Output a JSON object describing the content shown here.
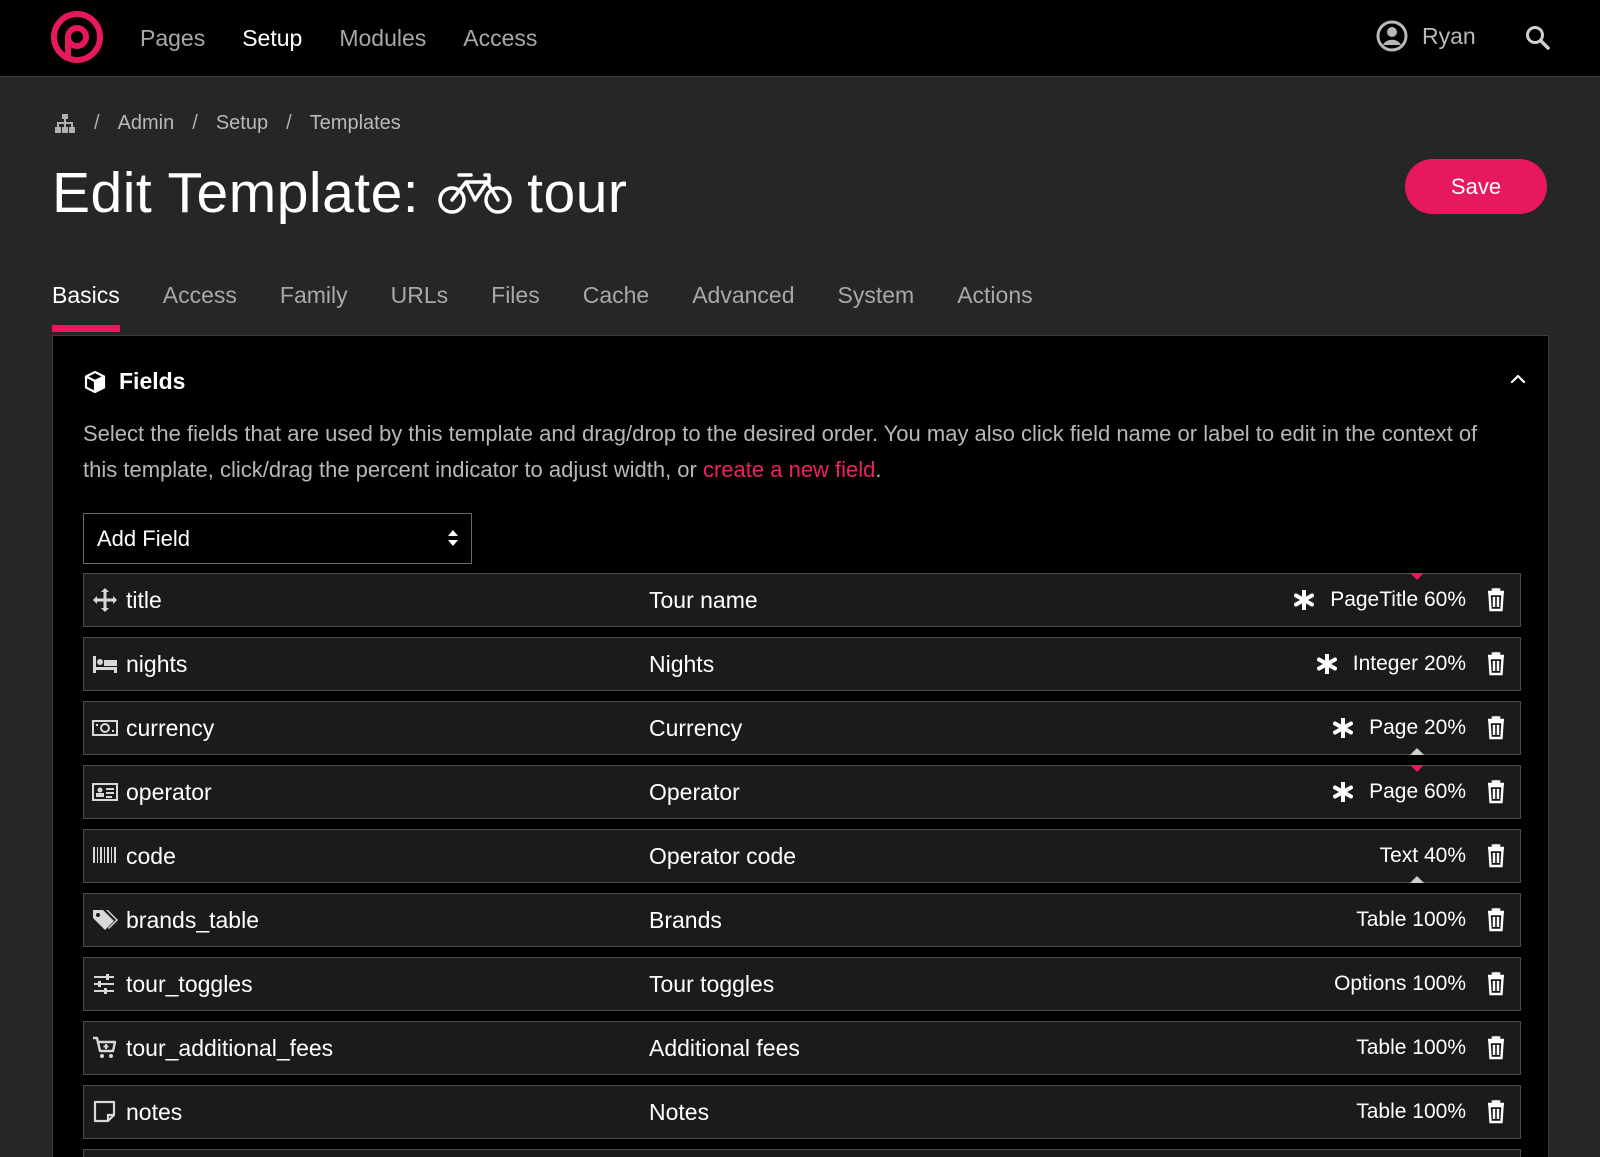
{
  "nav": {
    "items": [
      {
        "label": "Pages",
        "active": false
      },
      {
        "label": "Setup",
        "active": true
      },
      {
        "label": "Modules",
        "active": false
      },
      {
        "label": "Access",
        "active": false
      }
    ],
    "user": "Ryan"
  },
  "breadcrumb": [
    "Admin",
    "Setup",
    "Templates"
  ],
  "title": {
    "prefix": "Edit Template:",
    "name": "tour"
  },
  "save_label": "Save",
  "tabs": [
    "Basics",
    "Access",
    "Family",
    "URLs",
    "Files",
    "Cache",
    "Advanced",
    "System",
    "Actions"
  ],
  "panel": {
    "title": "Fields",
    "description": "Select the fields that are used by this template and drag/drop to the desired order. You may also click field name or label to edit in the context of this template, click/drag the percent indicator to adjust width, or ",
    "link": "create a new field",
    "description_end": "."
  },
  "add_field": {
    "value": "Add Field"
  },
  "colors": {
    "accent": "#e8185f",
    "background": "#262626",
    "panel": "#000000",
    "row": "#1b1b1b"
  },
  "fields": [
    {
      "name": "title",
      "label": "Tour name",
      "type": "PageTitle",
      "width": "60%",
      "required": true,
      "icon": "move-icon"
    },
    {
      "name": "nights",
      "label": "Nights",
      "type": "Integer",
      "width": "20%",
      "required": true,
      "icon": "bed-icon"
    },
    {
      "name": "currency",
      "label": "Currency",
      "type": "Page",
      "width": "20%",
      "required": true,
      "icon": "money-icon"
    },
    {
      "name": "operator",
      "label": "Operator",
      "type": "Page",
      "width": "60%",
      "required": true,
      "icon": "id-card-icon"
    },
    {
      "name": "code",
      "label": "Operator code",
      "type": "Text",
      "width": "40%",
      "required": false,
      "icon": "barcode-icon"
    },
    {
      "name": "brands_table",
      "label": "Brands",
      "type": "Table",
      "width": "100%",
      "required": false,
      "icon": "tags-icon"
    },
    {
      "name": "tour_toggles",
      "label": "Tour toggles",
      "type": "Options",
      "width": "100%",
      "required": false,
      "icon": "sliders-icon"
    },
    {
      "name": "tour_additional_fees",
      "label": "Additional fees",
      "type": "Table",
      "width": "100%",
      "required": false,
      "icon": "cart-icon"
    },
    {
      "name": "notes",
      "label": "Notes",
      "type": "Table",
      "width": "100%",
      "required": false,
      "icon": "note-icon"
    }
  ]
}
